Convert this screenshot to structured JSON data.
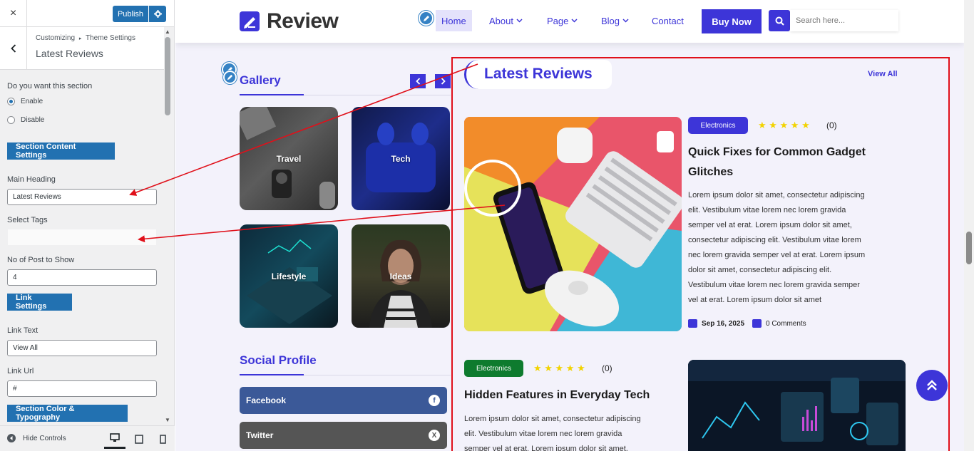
{
  "sidebar": {
    "close_icon": "×",
    "publish_label": "Publish",
    "breadcrumb_root": "Customizing",
    "breadcrumb_sep": "▸",
    "breadcrumb_parent": "Theme Settings",
    "title": "Latest Reviews",
    "section_question": "Do you want this section",
    "radio_enable": "Enable",
    "radio_disable": "Disable",
    "btn_content": "Section Content Settings",
    "label_heading": "Main Heading",
    "value_heading": "Latest Reviews",
    "label_tags": "Select Tags",
    "label_posts": "No of Post to Show",
    "value_posts": "4",
    "btn_link": "Link Settings",
    "label_link_text": "Link Text",
    "value_link_text": "View All",
    "label_link_url": "Link Url",
    "value_link_url": "#",
    "btn_color": "Section Color & Typography",
    "hide_controls": "Hide Controls"
  },
  "site": {
    "logo_text": "Review",
    "nav": [
      {
        "label": "Home"
      },
      {
        "label": "About"
      },
      {
        "label": "Page"
      },
      {
        "label": "Blog"
      },
      {
        "label": "Contact"
      }
    ],
    "buy_now": "Buy Now",
    "search_placeholder": "Search here...",
    "gallery_title": "Gallery",
    "gallery_tiles": [
      "Travel",
      "Tech",
      "Lifestyle",
      "Ideas"
    ],
    "social_title": "Social Profile",
    "social_items": [
      {
        "label": "Facebook",
        "icon": "f",
        "color": "#3b5998"
      },
      {
        "label": "Twitter",
        "icon": "X",
        "color": "#555555"
      }
    ],
    "reviews_title": "Latest Reviews",
    "reviews_link": "View All",
    "posts": [
      {
        "category": "Electronics",
        "category_color": "#3d35d8",
        "stars": "★ ★ ★ ★ ★",
        "rating_count": "(0)",
        "title_line1": "Quick Fixes for Common Gadget",
        "title_line2": "Glitches",
        "body": [
          "Lorem ipsum dolor sit amet, consectetur adipiscing",
          "elit. Vestibulum vitae lorem nec lorem gravida",
          "semper vel at erat. Lorem ipsum dolor sit amet,",
          "consectetur adipiscing elit. Vestibulum vitae lorem",
          "nec lorem gravida semper vel at erat. Lorem ipsum",
          "dolor sit amet, consectetur adipiscing elit.",
          "Vestibulum vitae lorem nec lorem gravida semper",
          "vel at erat. Lorem ipsum dolor sit amet"
        ],
        "date": "Sep 16, 2025",
        "comments": "0 Comments"
      },
      {
        "category": "Electronics",
        "category_color": "#0e7b2e",
        "stars": "★ ★ ★ ★ ★",
        "rating_count": "(0)",
        "title_line1": "Hidden Features in Everyday Tech",
        "body": [
          "Lorem ipsum dolor sit amet, consectetur adipiscing",
          "elit. Vestibulum vitae lorem nec lorem gravida",
          "semper vel at erat. Lorem ipsum dolor sit amet,"
        ]
      }
    ]
  },
  "colors": {
    "accent": "#3d35d8",
    "wp_blue": "#2271b1",
    "annotation_red": "#e0101a"
  }
}
